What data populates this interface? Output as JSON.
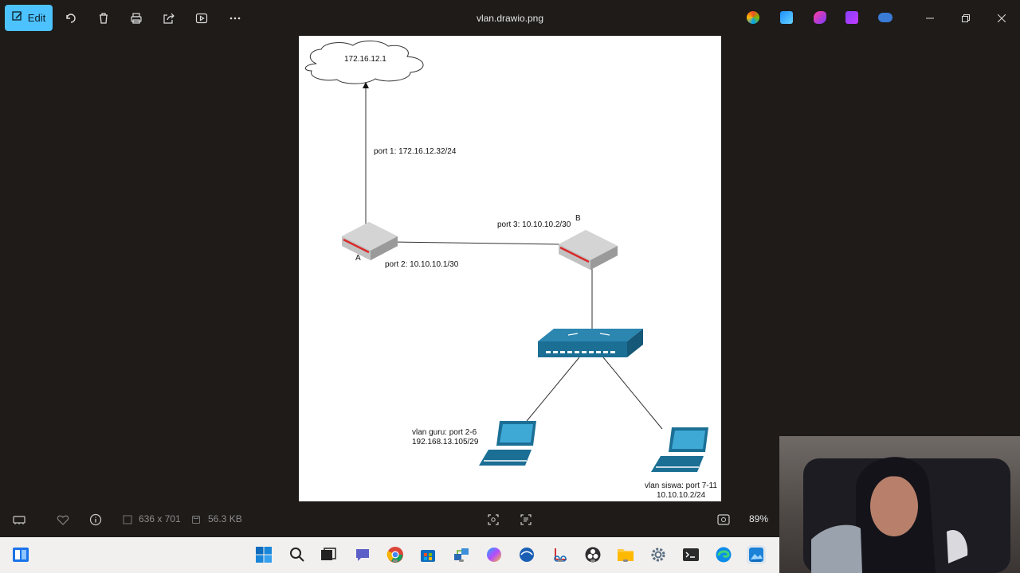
{
  "window": {
    "title": "vlan.drawio.png",
    "edit_label": "Edit"
  },
  "toolbar": {
    "icons": [
      "rotate-icon",
      "delete-icon",
      "print-icon",
      "share-icon",
      "slideshow-icon",
      "more-icon"
    ]
  },
  "diagram": {
    "cloud_label": "172.16.12.1",
    "port1_label": "port 1: 172.16.12.32/24",
    "router_a_label": "A",
    "router_b_label": "B",
    "port2_label": "port 2: 10.10.10.1/30",
    "port3_label": "port 3: 10.10.10.2/30",
    "vlan_guru_line1": "vlan guru: port 2-6",
    "vlan_guru_line2": "192.168.13.105/29",
    "vlan_siswa_line1": "vlan siswa: port 7-11",
    "vlan_siswa_line2": "10.10.10.2/24"
  },
  "status": {
    "dimensions": "636 x 701",
    "file_size": "56.3 KB",
    "zoom": "89%"
  },
  "colors": {
    "accent": "#4cc2ff",
    "device_blue": "#1b6f95",
    "router_red": "#d92a2a"
  }
}
